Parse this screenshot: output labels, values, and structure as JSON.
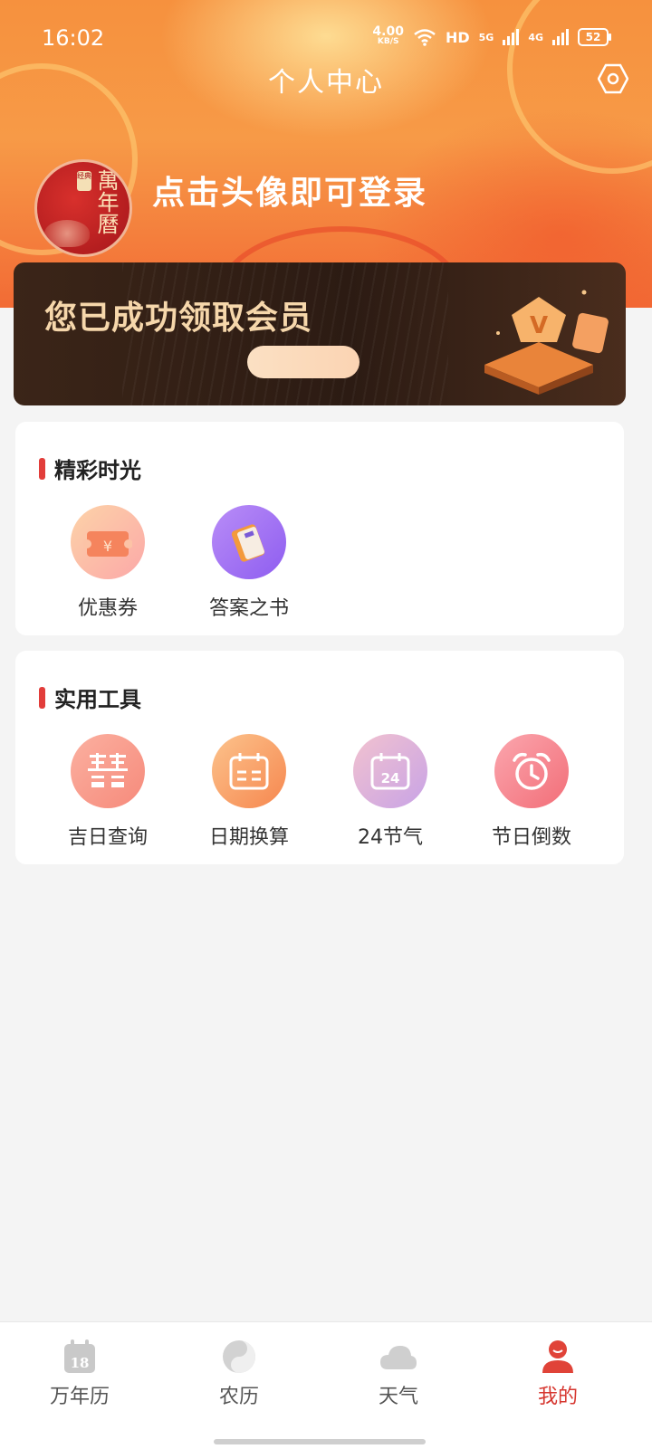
{
  "status_bar": {
    "time": "16:02",
    "net_speed_value": "4.00",
    "net_speed_unit": "KB/S",
    "hd_label": "HD",
    "net1": "5G",
    "net2": "4G",
    "battery": "52"
  },
  "header": {
    "title": "个人中心",
    "login_prompt": "点击头像即可登录",
    "avatar_text": "萬年曆",
    "avatar_seal": "经典"
  },
  "vip_banner": {
    "text": "您已成功领取会员"
  },
  "sections": {
    "highlights": {
      "title": "精彩时光",
      "items": [
        {
          "label": "优惠券",
          "icon": "coupon-icon"
        },
        {
          "label": "答案之书",
          "icon": "answer-book-icon"
        }
      ]
    },
    "tools": {
      "title": "实用工具",
      "items": [
        {
          "label": "吉日查询",
          "icon": "double-happiness-icon"
        },
        {
          "label": "日期换算",
          "icon": "calendar-convert-icon"
        },
        {
          "label": "24节气",
          "icon": "calendar-24-icon"
        },
        {
          "label": "节日倒数",
          "icon": "alarm-clock-icon"
        }
      ]
    }
  },
  "tabbar": {
    "tabs": [
      {
        "label": "万年历",
        "icon": "calendar-icon",
        "badge": "18"
      },
      {
        "label": "农历",
        "icon": "yin-yang-icon"
      },
      {
        "label": "天气",
        "icon": "cloud-icon"
      },
      {
        "label": "我的",
        "icon": "user-icon",
        "active": true
      }
    ]
  },
  "colors": {
    "accent": "#d6362f",
    "header_orange": "#f6913e",
    "vip_dark": "#2c1b13",
    "vip_gold": "#f6d7ab"
  }
}
